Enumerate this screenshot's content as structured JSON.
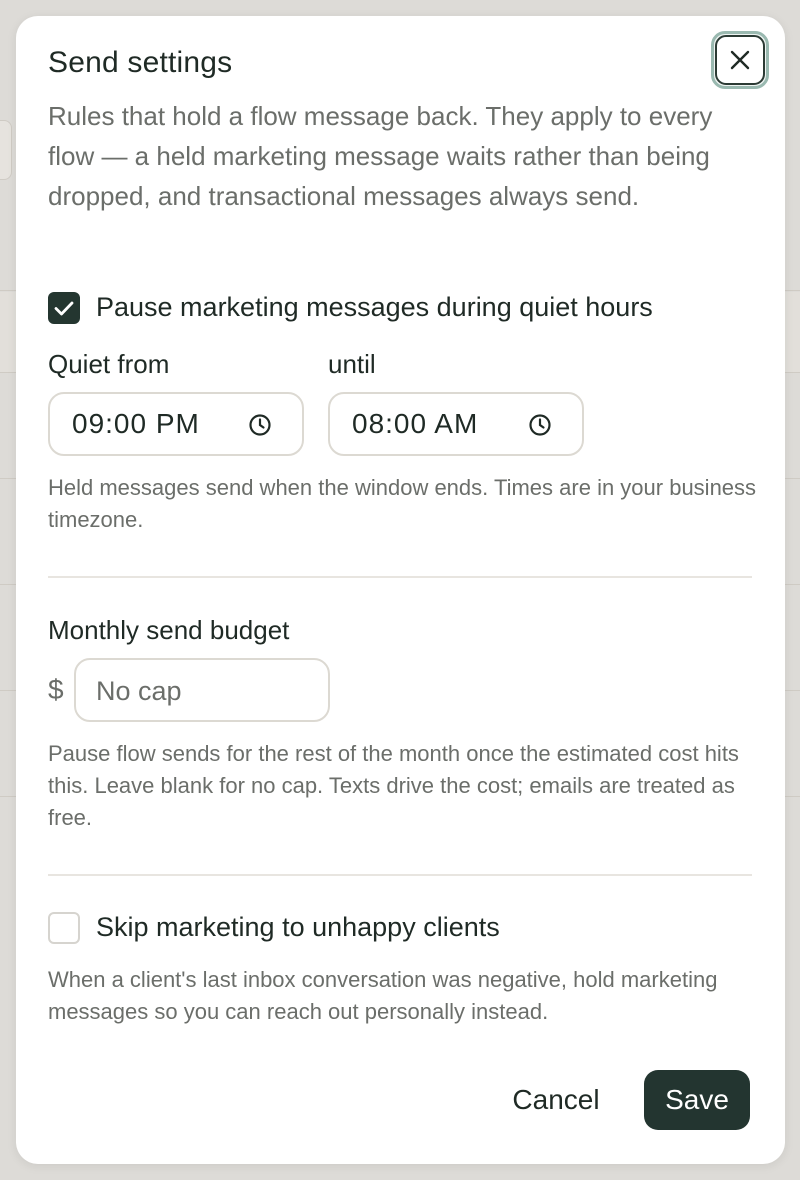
{
  "modal": {
    "title": "Send settings",
    "close_icon": "close-icon",
    "intro": "Rules that hold a flow message back. They apply to every flow — a held marketing message waits rather than being dropped, and transactional messages always send."
  },
  "quiet_hours": {
    "checkbox_label": "Pause marketing messages during quiet hours",
    "checked": true,
    "from_label": "Quiet from",
    "until_label": "until",
    "from_value": "09:00 PM",
    "until_value": "08:00 AM",
    "clock_icon": "clock-icon",
    "help": "Held messages send when the window ends. Times are in your business timezone."
  },
  "budget": {
    "label": "Monthly send budget",
    "currency": "$",
    "placeholder": "No cap",
    "value": "",
    "help": "Pause flow sends for the rest of the month once the estimated cost hits this. Leave blank for no cap. Texts drive the cost; emails are treated as free."
  },
  "unhappy": {
    "checkbox_label": "Skip marketing to unhappy clients",
    "checked": false,
    "help": "When a client's last inbox conversation was negative, hold marketing messages so you can reach out personally instead."
  },
  "actions": {
    "cancel_label": "Cancel",
    "save_label": "Save"
  },
  "colors": {
    "primary": "#233530",
    "focus_ring": "#9ab9b0",
    "muted_text": "#6b6e6a",
    "backdrop": "#dddbd7"
  }
}
